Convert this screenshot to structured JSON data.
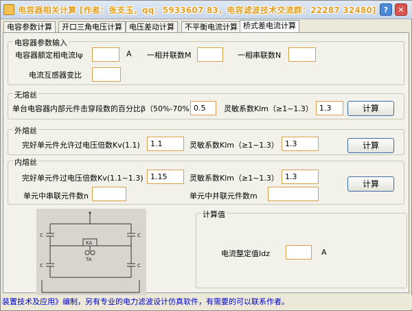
{
  "title": "电容器相关计算 [作者：张支玉，qq：5933607 83，电容滤波技术交流群：22287 32480]",
  "tabs": [
    "电容参数计算",
    "开口三角电压计算",
    "电压差动计算",
    "不平衡电流计算",
    "桥式差电流计算"
  ],
  "active_tab": 4,
  "params": {
    "title": "电容器参数输入",
    "rated_current_label": "电容器额定相电流Iψ",
    "rated_current_unit": "A",
    "parallel_label": "一相并联数M",
    "series_label": "一相串联数N",
    "ct_ratio_label": "电流互感器变比",
    "rated_current_value": "",
    "parallel_value": "",
    "series_value": "",
    "ct_ratio_value": ""
  },
  "no_fuse": {
    "title": "无熔丝",
    "percent_label": "单台电容器内部元件击穿段数的百分比β（50%-70%）",
    "percent_value": "0.5",
    "sens_label": "灵敏系数Klm（≥1~1.3）",
    "sens_value": "1.3",
    "calc_label": "计算"
  },
  "ext_fuse": {
    "title": "外熔丝",
    "kv_label": "完好单元件允许过电压倍数Kv(1.1)",
    "kv_value": "1.1",
    "sens_label": "灵敏系数Klm（≥1~1.3）",
    "sens_value": "1.3",
    "calc_label": "计算"
  },
  "int_fuse": {
    "title": "内熔丝",
    "kv_label": "完好单元件过电压倍数Kv(1.1~1.3)",
    "kv_value": "1.15",
    "sens_label": "灵敏系数Klm（≥1~1.3）",
    "sens_value": "1.3",
    "series_label": "单元中串联元件数n",
    "series_value": "",
    "parallel_label": "单元中并联元件数m",
    "parallel_value": "",
    "calc_label": "计算"
  },
  "result": {
    "title": "计算值",
    "idz_label": "电流整定值Idz",
    "idz_value": "",
    "idz_unit": "A"
  },
  "diagram": {
    "ka_label": "KA",
    "ta_label": "TA",
    "c_label": "C"
  },
  "status_text": "装置技术及应用》编制，另有专业的电力滤波设计仿真软件，有需要的可以联系作者。",
  "colors": {
    "title_text": "#e4a020",
    "input_border": "#d9a04b",
    "status_text": "#0000cc"
  }
}
